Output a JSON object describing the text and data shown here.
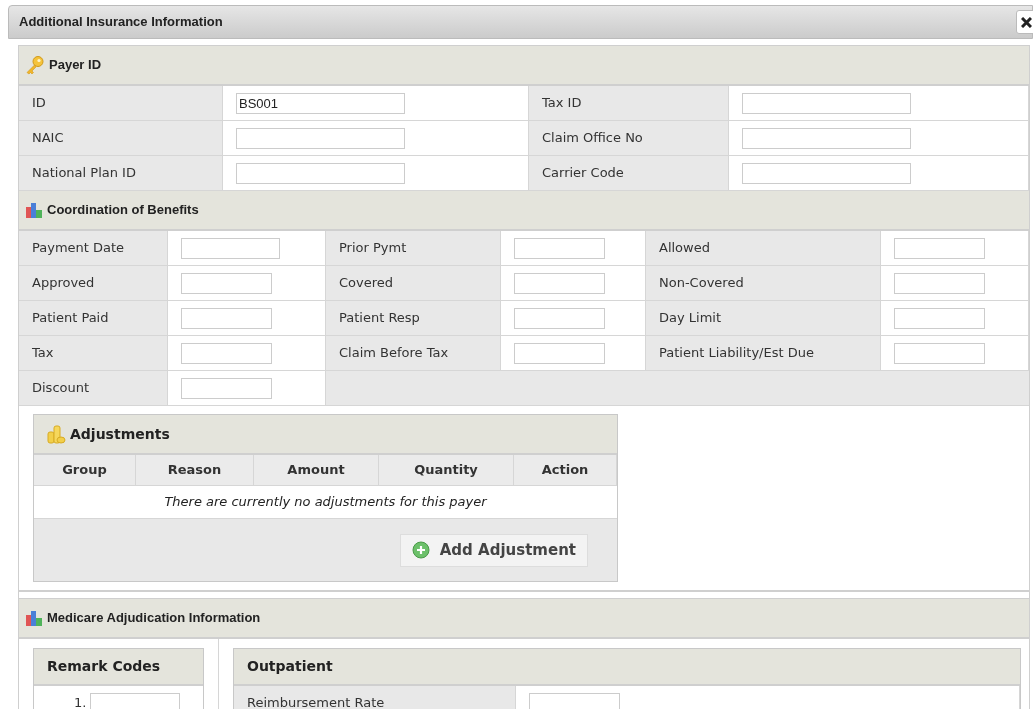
{
  "window": {
    "title": "Additional Insurance Information"
  },
  "payer_id": {
    "title": "Payer ID",
    "fields": [
      {
        "label": "ID",
        "value": "BS001"
      },
      {
        "label": "Tax ID"
      },
      {
        "label": "NAIC"
      },
      {
        "label": "Claim Office No"
      },
      {
        "label": "National Plan ID"
      },
      {
        "label": "Carrier Code"
      }
    ]
  },
  "coordination_of_benefits": {
    "title": "Coordination of Benefits",
    "fields": [
      {
        "label": "Payment Date"
      },
      {
        "label": "Prior Pymt"
      },
      {
        "label": "Allowed"
      },
      {
        "label": "Approved"
      },
      {
        "label": "Covered"
      },
      {
        "label": "Non-Covered"
      },
      {
        "label": "Patient Paid"
      },
      {
        "label": "Patient Resp"
      },
      {
        "label": "Day Limit"
      },
      {
        "label": "Tax"
      },
      {
        "label": "Claim Before Tax"
      },
      {
        "label": "Patient Liability/Est Due"
      },
      {
        "label": "Discount"
      }
    ]
  },
  "adjustments": {
    "title": "Adjustments",
    "columns": [
      "Group",
      "Reason",
      "Amount",
      "Quantity",
      "Action"
    ],
    "empty_message": "There are currently no adjustments for this payer",
    "button": "Add Adjustment"
  },
  "medicare_adjudication": {
    "title": "Medicare Adjudication Information",
    "remark_codes": {
      "title": "Remark Codes",
      "items": [
        {
          "number": "1."
        }
      ]
    },
    "outpatient": {
      "title": "Outpatient",
      "fields": [
        {
          "label": "Reimbursement Rate"
        }
      ]
    }
  }
}
